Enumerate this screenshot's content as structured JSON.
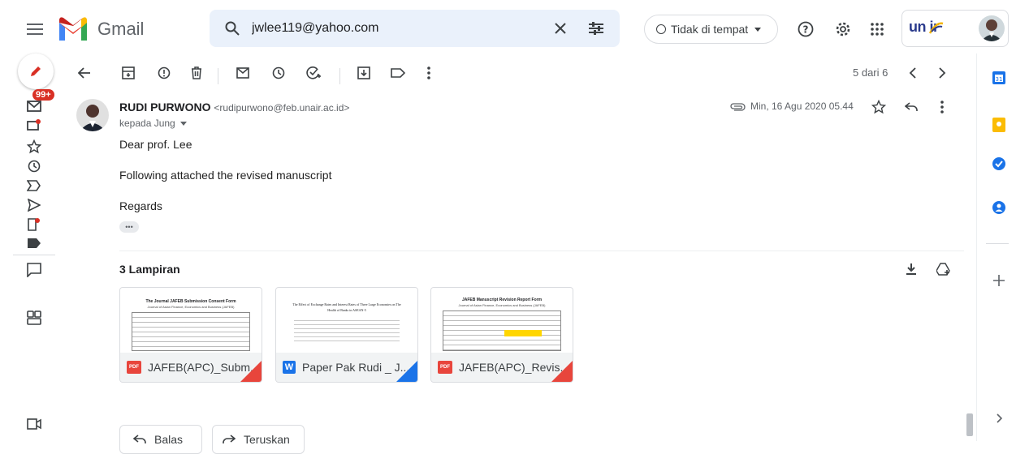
{
  "header": {
    "app_name": "Gmail",
    "search_value": "jwlee119@yahoo.com",
    "status_label": "Tidak di tempat",
    "brand_text": "un  ir"
  },
  "toolbar": {
    "pager_text": "5 dari 6"
  },
  "sidebar": {
    "inbox_badge": "99+"
  },
  "message": {
    "sender_name": "RUDI PURWONO",
    "sender_email": "<rudipurwono@feb.unair.ac.id>",
    "recipient": "kepada Jung",
    "date": "Min, 16 Agu 2020 05.44",
    "lines": [
      "Dear prof. Lee",
      "Following attached the revised manuscript",
      "Regards"
    ],
    "ellipsis": "•••"
  },
  "attachments": {
    "title": "3 Lampiran",
    "items": [
      {
        "name": "JAFEB(APC)_Subm...",
        "type_label": "PDF",
        "corner_color": "#e8453c",
        "preview_title": "The Journal JAFEB Submission Consent Form",
        "preview_subtitle": "Journal of Asian Finance, Economics and Business (JAFEB)"
      },
      {
        "name": "Paper Pak Rudi _ J...",
        "type_label": "W",
        "corner_color": "#1a73e8",
        "preview_title": "The Effect of Exchange Rates and Interest Rates of Three Large Economies on The",
        "preview_subtitle": "Health of Banks in ASEAN-5"
      },
      {
        "name": "JAFEB(APC)_Revis...",
        "type_label": "PDF",
        "corner_color": "#e8453c",
        "preview_title": "JAFEB Manuscript Revision Report Form",
        "preview_subtitle": "Journal of Asian Finance, Economics and Business (JAFEB)"
      }
    ]
  },
  "actions": {
    "reply_label": "Balas",
    "forward_label": "Teruskan"
  },
  "colors": {
    "accent": "#1a73e8",
    "badge": "#d93025",
    "search_bg": "#eaf1fb"
  }
}
